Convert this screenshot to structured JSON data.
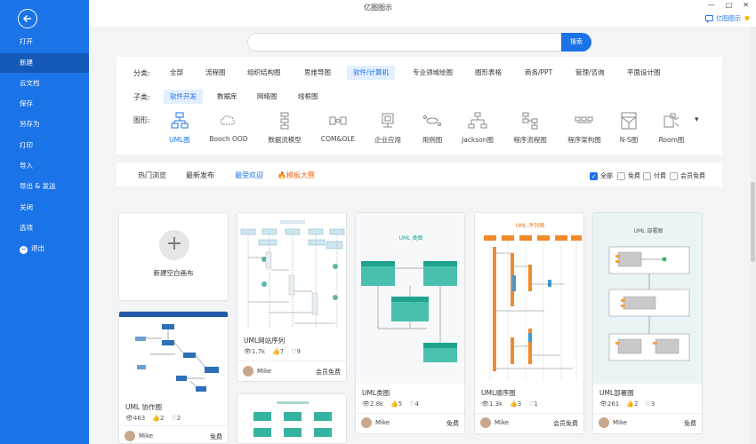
{
  "app": {
    "title": "亿图图示",
    "brand_label": "亿图图示"
  },
  "sidebar": {
    "items": [
      {
        "label": "打开"
      },
      {
        "label": "新建"
      },
      {
        "label": "云文档"
      },
      {
        "label": "保存"
      },
      {
        "label": "另存为"
      },
      {
        "label": "打印"
      },
      {
        "label": "导入"
      },
      {
        "label": "导出 & 发送"
      },
      {
        "label": "关闭"
      },
      {
        "label": "选项"
      },
      {
        "label": "退出"
      }
    ]
  },
  "search": {
    "button_label": "搜索",
    "value": "",
    "placeholder": ""
  },
  "filters": {
    "category_label": "分类:",
    "categories": [
      "全部",
      "流程图",
      "组织结构图",
      "思维导图",
      "软件/计算机",
      "专业领域绘图",
      "图形表格",
      "商务/PPT",
      "管理/咨询",
      "平面设计图"
    ],
    "subtype_label": "子类:",
    "subtypes": [
      "软件开发",
      "数据库",
      "网络图",
      "线框图"
    ],
    "shape_label": "图形:",
    "shapes": [
      "UML图",
      "Booch OOD",
      "数据流模型",
      "COM&OLE",
      "企业应用",
      "用例图",
      "Jackson图",
      "程序流程图",
      "程序架构图",
      "N-S图",
      "Room图"
    ]
  },
  "sort_tabs": {
    "items": [
      "热门浏览",
      "最新发布",
      "最受欢迎",
      "模板大赛"
    ],
    "filters": [
      {
        "label": "全部",
        "checked": true
      },
      {
        "label": "免费",
        "checked": false
      },
      {
        "label": "付费",
        "checked": false
      },
      {
        "label": "会员免费",
        "checked": false
      }
    ]
  },
  "new_blank": {
    "label": "新建空白画布"
  },
  "cards": [
    {
      "title": "UML 协作图",
      "views": "463",
      "likes": "2",
      "favs": "2",
      "author": "Mike",
      "price": "免费"
    },
    {
      "title": "UML网站序列",
      "views": "1.7k",
      "likes": "7",
      "favs": "9",
      "author": "Mike",
      "price": "会员免费"
    },
    {
      "title": "UML类图",
      "views": "2.8k",
      "likes": "5",
      "favs": "4",
      "author": "Mike",
      "price": "免费",
      "thumb_title": "UML 类图"
    },
    {
      "title": "UML顺序图",
      "views": "1.3k",
      "likes": "3",
      "favs": "1",
      "author": "Mike",
      "price": "会员免费",
      "thumb_title": "UML 序列图"
    },
    {
      "title": "UML部署图",
      "views": "261",
      "likes": "2",
      "favs": "3",
      "author": "Mike",
      "price": "免费",
      "thumb_title": "UML 部署图"
    }
  ],
  "colors": {
    "primary": "#1b73e8",
    "sidebar_active": "#1559b8",
    "hot": "#f06a1c",
    "teal": "#1fa38f",
    "orange": "#f08a2c"
  }
}
